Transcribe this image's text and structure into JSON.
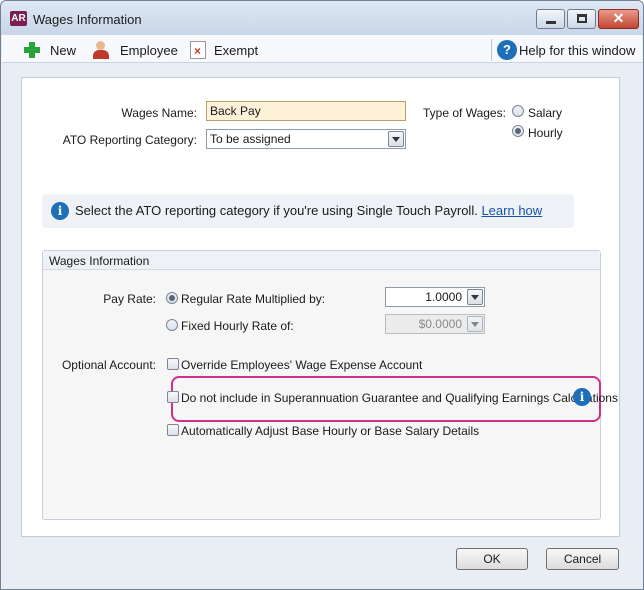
{
  "window": {
    "app_badge": "AR",
    "title": "Wages Information"
  },
  "toolbar": {
    "new_label": "New",
    "employee_label": "Employee",
    "exempt_label": "Exempt",
    "help_label": "Help for this window"
  },
  "form": {
    "wages_name_label": "Wages Name:",
    "wages_name_value": "Back Pay",
    "ato_label": "ATO Reporting Category:",
    "ato_value": "To be assigned",
    "type_label": "Type of Wages:",
    "type_options": [
      {
        "label": "Salary",
        "checked": false
      },
      {
        "label": "Hourly",
        "checked": true
      }
    ]
  },
  "info_bar": {
    "text": "Select the ATO reporting category if you're using Single Touch Payroll.",
    "link": "Learn how"
  },
  "wages_group": {
    "title": "Wages Information",
    "pay_rate_label": "Pay Rate:",
    "regular_label": "Regular Rate Multiplied by:",
    "regular_value": "1.0000",
    "regular_checked": true,
    "fixed_label": "Fixed Hourly Rate of:",
    "fixed_value": "$0.0000",
    "fixed_checked": false,
    "optional_label": "Optional Account:",
    "override_label": "Override Employees' Wage Expense Account",
    "super_label": "Do not include in Superannuation Guarantee and Qualifying Earnings Calculations",
    "adjust_label": "Automatically Adjust Base Hourly or Base Salary Details"
  },
  "buttons": {
    "ok": "OK",
    "cancel": "Cancel"
  },
  "colors": {
    "highlight": "#cf2f8d",
    "accent": "#1d6fb8"
  }
}
